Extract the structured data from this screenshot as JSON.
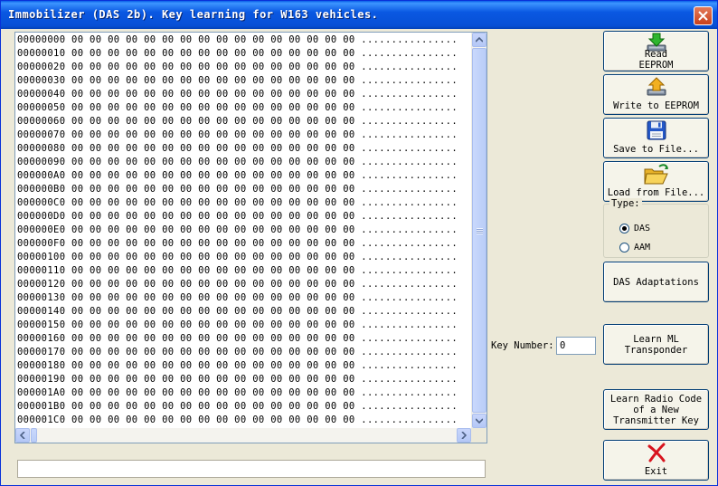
{
  "window": {
    "title": "Immobilizer (DAS 2b). Key learning for W163 vehicles."
  },
  "hex_rows": [
    {
      "addr": "00000000",
      "bytes": "00 00 00 00 00 00 00 00 00 00 00 00 00 00 00 00",
      "ascii": "................"
    },
    {
      "addr": "00000010",
      "bytes": "00 00 00 00 00 00 00 00 00 00 00 00 00 00 00 00",
      "ascii": "................"
    },
    {
      "addr": "00000020",
      "bytes": "00 00 00 00 00 00 00 00 00 00 00 00 00 00 00 00",
      "ascii": "................"
    },
    {
      "addr": "00000030",
      "bytes": "00 00 00 00 00 00 00 00 00 00 00 00 00 00 00 00",
      "ascii": "................"
    },
    {
      "addr": "00000040",
      "bytes": "00 00 00 00 00 00 00 00 00 00 00 00 00 00 00 00",
      "ascii": "................"
    },
    {
      "addr": "00000050",
      "bytes": "00 00 00 00 00 00 00 00 00 00 00 00 00 00 00 00",
      "ascii": "................"
    },
    {
      "addr": "00000060",
      "bytes": "00 00 00 00 00 00 00 00 00 00 00 00 00 00 00 00",
      "ascii": "................"
    },
    {
      "addr": "00000070",
      "bytes": "00 00 00 00 00 00 00 00 00 00 00 00 00 00 00 00",
      "ascii": "................"
    },
    {
      "addr": "00000080",
      "bytes": "00 00 00 00 00 00 00 00 00 00 00 00 00 00 00 00",
      "ascii": "................"
    },
    {
      "addr": "00000090",
      "bytes": "00 00 00 00 00 00 00 00 00 00 00 00 00 00 00 00",
      "ascii": "................"
    },
    {
      "addr": "000000A0",
      "bytes": "00 00 00 00 00 00 00 00 00 00 00 00 00 00 00 00",
      "ascii": "................"
    },
    {
      "addr": "000000B0",
      "bytes": "00 00 00 00 00 00 00 00 00 00 00 00 00 00 00 00",
      "ascii": "................"
    },
    {
      "addr": "000000C0",
      "bytes": "00 00 00 00 00 00 00 00 00 00 00 00 00 00 00 00",
      "ascii": "................"
    },
    {
      "addr": "000000D0",
      "bytes": "00 00 00 00 00 00 00 00 00 00 00 00 00 00 00 00",
      "ascii": "................"
    },
    {
      "addr": "000000E0",
      "bytes": "00 00 00 00 00 00 00 00 00 00 00 00 00 00 00 00",
      "ascii": "................"
    },
    {
      "addr": "000000F0",
      "bytes": "00 00 00 00 00 00 00 00 00 00 00 00 00 00 00 00",
      "ascii": "................"
    },
    {
      "addr": "00000100",
      "bytes": "00 00 00 00 00 00 00 00 00 00 00 00 00 00 00 00",
      "ascii": "................"
    },
    {
      "addr": "00000110",
      "bytes": "00 00 00 00 00 00 00 00 00 00 00 00 00 00 00 00",
      "ascii": "................"
    },
    {
      "addr": "00000120",
      "bytes": "00 00 00 00 00 00 00 00 00 00 00 00 00 00 00 00",
      "ascii": "................"
    },
    {
      "addr": "00000130",
      "bytes": "00 00 00 00 00 00 00 00 00 00 00 00 00 00 00 00",
      "ascii": "................"
    },
    {
      "addr": "00000140",
      "bytes": "00 00 00 00 00 00 00 00 00 00 00 00 00 00 00 00",
      "ascii": "................"
    },
    {
      "addr": "00000150",
      "bytes": "00 00 00 00 00 00 00 00 00 00 00 00 00 00 00 00",
      "ascii": "................"
    },
    {
      "addr": "00000160",
      "bytes": "00 00 00 00 00 00 00 00 00 00 00 00 00 00 00 00",
      "ascii": "................"
    },
    {
      "addr": "00000170",
      "bytes": "00 00 00 00 00 00 00 00 00 00 00 00 00 00 00 00",
      "ascii": "................"
    },
    {
      "addr": "00000180",
      "bytes": "00 00 00 00 00 00 00 00 00 00 00 00 00 00 00 00",
      "ascii": "................"
    },
    {
      "addr": "00000190",
      "bytes": "00 00 00 00 00 00 00 00 00 00 00 00 00 00 00 00",
      "ascii": "................"
    },
    {
      "addr": "000001A0",
      "bytes": "00 00 00 00 00 00 00 00 00 00 00 00 00 00 00 00",
      "ascii": "................"
    },
    {
      "addr": "000001B0",
      "bytes": "00 00 00 00 00 00 00 00 00 00 00 00 00 00 00 00",
      "ascii": "................"
    },
    {
      "addr": "000001C0",
      "bytes": "00 00 00 00 00 00 00 00 00 00 00 00 00 00 00 00",
      "ascii": "................"
    }
  ],
  "buttons": {
    "read_eeprom": {
      "label": "Read\nEEPROM",
      "icon": "download-arrow-icon"
    },
    "write_eeprom": {
      "label": "Write to EEPROM",
      "icon": "upload-arrow-icon"
    },
    "save_file": {
      "label": "Save to File...",
      "icon": "floppy-disk-icon"
    },
    "load_file": {
      "label": "Load from File...",
      "icon": "open-folder-icon"
    },
    "das_adaptations": {
      "label": "DAS Adaptations"
    },
    "learn_ml": {
      "label": "Learn ML\nTransponder"
    },
    "learn_radio": {
      "label": "Learn Radio Code\nof a New\nTransmitter Key"
    },
    "exit": {
      "label": "Exit",
      "icon": "red-x-icon"
    }
  },
  "type_group": {
    "legend": "Type:",
    "options": [
      {
        "label": "DAS",
        "selected": true
      },
      {
        "label": "AAM",
        "selected": false
      }
    ]
  },
  "key_number": {
    "label": "Key Number:",
    "value": "0"
  },
  "colors": {
    "titlebar": "#0A58E2",
    "close_button": "#C9401B",
    "face": "#ECE9D8",
    "button_border": "#003C74"
  }
}
